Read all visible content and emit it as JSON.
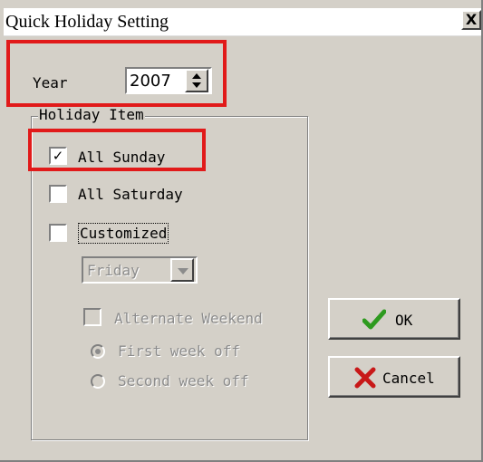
{
  "window": {
    "title": "Quick Holiday Setting",
    "close_label": "X"
  },
  "year": {
    "label": "Year",
    "value": "2007"
  },
  "holiday_item": {
    "group_label": "Holiday Item",
    "all_sunday": {
      "label": "All Sunday",
      "checked": true
    },
    "all_saturday": {
      "label": "All Saturday",
      "checked": false
    },
    "customized": {
      "label": "Customized",
      "checked": false
    },
    "day_select": {
      "value": "Friday",
      "enabled": false
    },
    "alternate_weekend": {
      "label": "Alternate Weekend",
      "checked": false,
      "enabled": false
    },
    "first_week_off": {
      "label": "First week off",
      "selected": true,
      "enabled": false
    },
    "second_week_off": {
      "label": "Second week off",
      "selected": false,
      "enabled": false
    }
  },
  "buttons": {
    "ok_label": "OK",
    "cancel_label": "Cancel"
  },
  "colors": {
    "dialog_bg": "#d4d0c8",
    "highlight": "#e11a1a",
    "ok_icon": "#2e9a1f",
    "cancel_icon": "#c81818"
  },
  "icons": {
    "ok": "checkmark-icon",
    "cancel": "x-icon",
    "close": "close-icon"
  }
}
